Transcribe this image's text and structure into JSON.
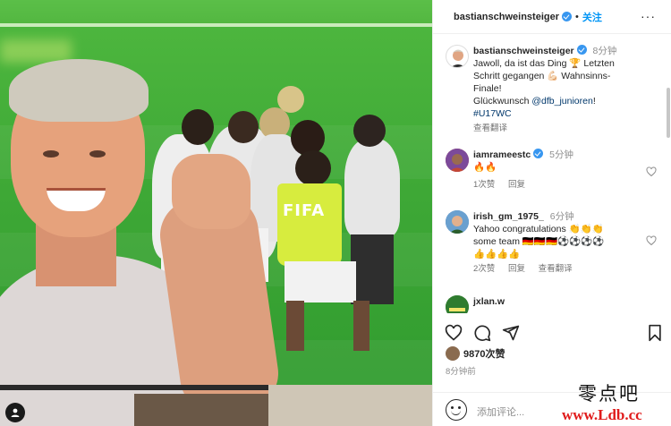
{
  "header": {
    "username": "bastianschweinsteiger",
    "separator": "•",
    "follow_label": "关注",
    "more_label": "···"
  },
  "caption": {
    "username": "bastianschweinsteiger",
    "time": "8分钟",
    "line1": "Jawoll, da ist das Ding 🏆 Letzten",
    "line2": "Schritt gegangen 💪🏻 Wahnsinns-",
    "line3": "Finale!",
    "line4a": "Glückwunsch ",
    "mention": "@dfb_junioren",
    "line4b": "!",
    "hashtag": "#U17WC",
    "translate_label": "查看翻译"
  },
  "comments": [
    {
      "username": "iamrameestc",
      "time": "5分钟",
      "text": "🔥🔥",
      "likes": "1次赞",
      "reply": "回复",
      "translate": ""
    },
    {
      "username": "irish_gm_1975_",
      "time": "6分钟",
      "line1": "Yahoo congratulations 👏👏👏",
      "line2": "some team 🇩🇪🇩🇪🇩🇪⚽⚽⚽⚽",
      "line3": "👍👍👍👍",
      "likes": "2次赞",
      "reply": "回复",
      "translate": "查看翻译"
    },
    {
      "username": "jxlan.w"
    }
  ],
  "post": {
    "likes": "9870次赞",
    "ago": "8分钟前",
    "add_comment_placeholder": "添加评论..."
  },
  "photo": {
    "vest_text": "FIFA"
  },
  "watermark": {
    "cn": "零点吧",
    "url": "www.Ldb.cc"
  },
  "icons": [
    "verified-icon",
    "heart-icon",
    "comment-icon",
    "share-icon",
    "bookmark-icon",
    "emoji-icon",
    "user-tag-icon"
  ],
  "colors": {
    "accent": "#0095f6",
    "verified": "#3897f0",
    "mention": "#00376b",
    "watermark": "#e01b1b"
  }
}
